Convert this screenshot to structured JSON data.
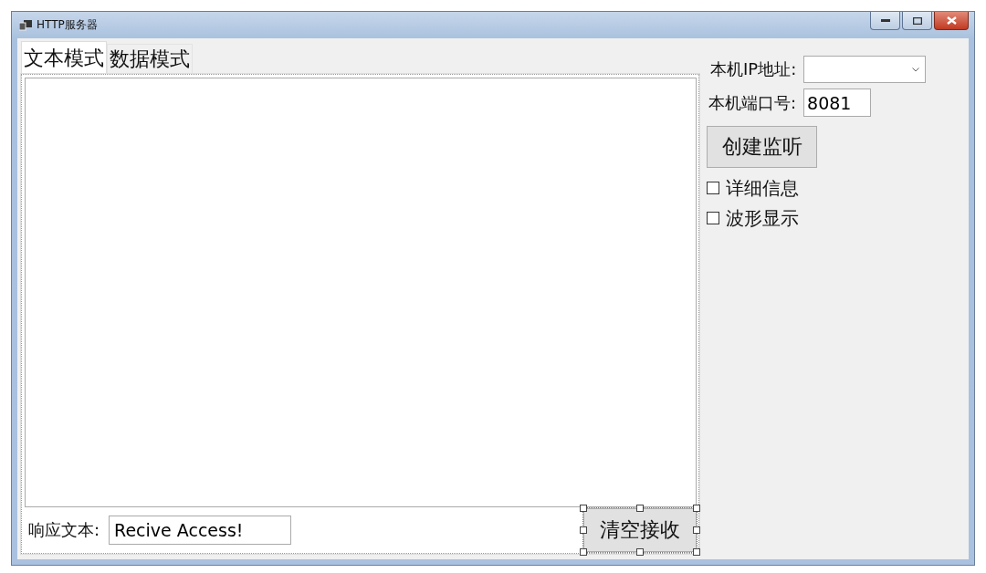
{
  "window": {
    "title": "HTTP服务器"
  },
  "tabs": [
    {
      "label": "文本模式",
      "selected": true
    },
    {
      "label": "数据模式",
      "selected": false
    }
  ],
  "response": {
    "label": "响应文本:",
    "value": "Recive Access!"
  },
  "clear_button": {
    "label": "清空接收",
    "selected": true
  },
  "ip": {
    "label": "本机IP地址:"
  },
  "port": {
    "label": "本机端口号:",
    "value": "8081"
  },
  "listen_button": {
    "label": "创建监听"
  },
  "options": [
    {
      "label": "详细信息",
      "checked": false
    },
    {
      "label": "波形显示",
      "checked": false
    }
  ]
}
